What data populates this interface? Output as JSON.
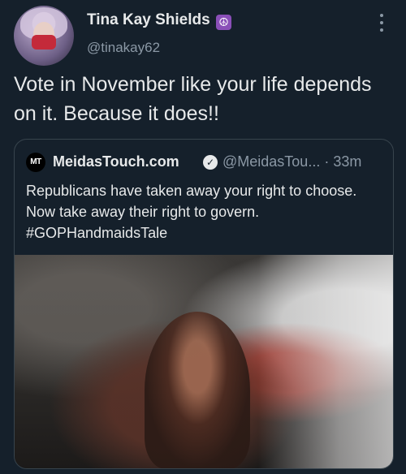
{
  "author": {
    "display_name": "Tina Kay Shields",
    "badge_icon": "peace-symbol-icon",
    "badge_glyph": "☮",
    "handle": "@tinakay62"
  },
  "tweet": {
    "text": "Vote in November like your life depends on it.  Because it does!!"
  },
  "quoted": {
    "avatar_text": "MT",
    "display_name": "MeidasTouch.com",
    "handle_time": "@MeidasTou... · 33m",
    "text": "Republicans have taken away your right to choose. Now take away their right to govern. #GOPHandmaidsTale"
  },
  "colors": {
    "background": "#15202b",
    "text": "#e7e9ea",
    "secondary": "#8b98a5",
    "border": "#38444d"
  }
}
